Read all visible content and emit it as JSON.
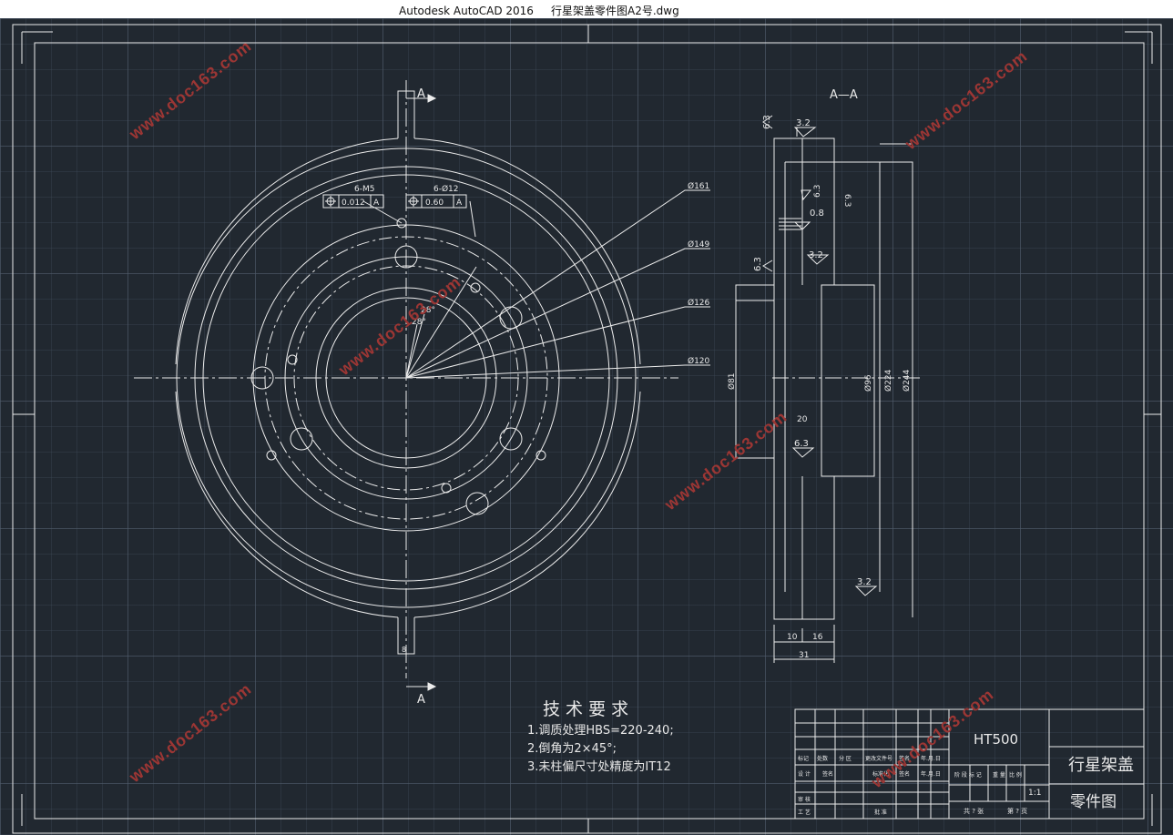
{
  "window": {
    "app": "Autodesk AutoCAD 2016",
    "file": "行星架盖零件图A2号.dwg"
  },
  "section_labels": {
    "top": "A",
    "bottom": "A",
    "view": "A—A"
  },
  "callouts": {
    "m5": {
      "label": "6-M5",
      "tol": "0.012",
      "datum": "A"
    },
    "d12": {
      "label": "6-Ø12",
      "tol": "0.60",
      "datum": "A"
    }
  },
  "front_dims": {
    "d161": "Ø161",
    "d149": "Ø149",
    "d126": "Ø126",
    "d120": "Ø120",
    "angle1": "28°",
    "angle2": "28°",
    "slot": "8"
  },
  "side_dims": {
    "d81": "Ø81",
    "d96": "Ø96",
    "d224": "Ø224",
    "d244": "Ø244",
    "w20": "20",
    "w10": "10",
    "w16": "16",
    "w31": "31"
  },
  "roughness": {
    "r1": "3.2",
    "r2": "6.3",
    "r3": "6.3",
    "r4": "6.3",
    "r5": "0.8",
    "r6": "3.2",
    "r7": "6.3",
    "r8": "6.3",
    "r9": "3.2"
  },
  "tech": {
    "title": "技 术 要 求",
    "items": [
      "1.调质处理HBS=220-240;",
      "2.倒角为2×45°;",
      "3.未柱偏尺寸处精度为IT12"
    ]
  },
  "titleblock": {
    "material": "HT500",
    "part_name": "行星架盖",
    "drawing_type": "零件图",
    "scale": "1:1",
    "headers": [
      "标记",
      "处数",
      "分 区",
      "更改文件号",
      "签名",
      "年.月.日"
    ],
    "row2": [
      "设 计",
      "签名",
      "标准化",
      "签名",
      "年.月.日"
    ],
    "row3": [
      "审 核"
    ],
    "row4": [
      "工 艺",
      "批 准"
    ],
    "stage_headers": [
      "阶 段 标 记",
      "重 量",
      "比 例"
    ],
    "sheets": [
      "共 ? 张",
      "第 ? 页"
    ]
  },
  "watermark": "www.doc163.com"
}
